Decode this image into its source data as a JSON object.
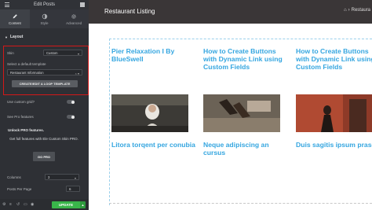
{
  "panel": {
    "header_title": "Edit Posts",
    "tabs": [
      {
        "label": "Content",
        "icon": "pencil-icon"
      },
      {
        "label": "Style",
        "icon": "half-circle-icon"
      },
      {
        "label": "Advanced",
        "icon": "gear-icon"
      }
    ],
    "section_title": "Layout",
    "skin_label": "Skin",
    "skin_value": "Custom",
    "template_label": "Select a default template",
    "template_value": "Restaurant Information",
    "template_button": "CREATE/EDIT A LOOP TEMPLATE",
    "custom_grid_label": "Use custom grid?",
    "pro_features_label": "See Pro features",
    "pro_title": "Unlock PRO features.",
    "pro_text": "Get full features with Ele Custom Skin PRO.",
    "pro_button": "GO PRO",
    "columns_label": "Columns",
    "columns_value": "3",
    "posts_per_page_label": "Posts Per Page",
    "posts_per_page_value": "6",
    "update_button": "UPDATE",
    "highlight_color": "#d41818",
    "update_color": "#39b54a"
  },
  "preview": {
    "page_title": "Restaurant Listing",
    "breadcrumb_text": "Restaura",
    "link_color": "#35a6e0",
    "cards": [
      {
        "title": "Pier Relaxation I By BlueSwell",
        "excerpt": "Litora torqent per conubia"
      },
      {
        "title": "How to Create Buttons with Dynamic Link using Custom Fields",
        "excerpt": "Neque adipiscing an cursus"
      },
      {
        "title": "How to Create Buttons with Dynamic Link using Custom Fields",
        "excerpt": "Duis sagitis ipsum prasent"
      }
    ]
  }
}
